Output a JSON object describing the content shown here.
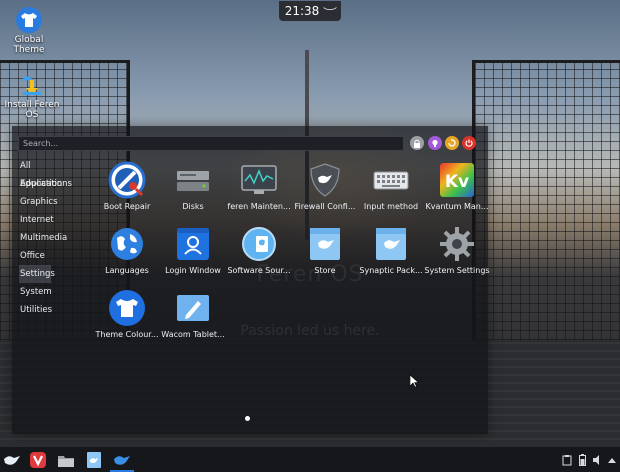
{
  "clock": {
    "time": "21:38",
    "chevron": "︶"
  },
  "desktop": {
    "icons": [
      {
        "name": "Global Theme",
        "icon": "tshirt-icon"
      },
      {
        "name": "Install Feren OS",
        "icon": "installer-icon"
      }
    ]
  },
  "launcher": {
    "search_placeholder": "Search...",
    "action_buttons": [
      {
        "icon": "lock-icon",
        "color": "#9aa0a6"
      },
      {
        "icon": "bulb-icon",
        "color": "#a15bd8"
      },
      {
        "icon": "switch-user-icon",
        "color": "#e6a526"
      },
      {
        "icon": "power-icon",
        "color": "#d8342c"
      }
    ],
    "categories": [
      {
        "label": "All Applications",
        "active": false
      },
      {
        "label": "Education",
        "active": false
      },
      {
        "label": "Graphics",
        "active": false
      },
      {
        "label": "Internet",
        "active": false
      },
      {
        "label": "Multimedia",
        "active": false
      },
      {
        "label": "Office",
        "active": false
      },
      {
        "label": "Settings",
        "active": true
      },
      {
        "label": "System",
        "active": false
      },
      {
        "label": "Utilities",
        "active": false
      }
    ],
    "apps": [
      {
        "label": "Boot Repair",
        "icon": "lifebuoy-icon"
      },
      {
        "label": "Disks",
        "icon": "disk-icon"
      },
      {
        "label": "feren Mainten...",
        "icon": "monitor-icon"
      },
      {
        "label": "Firewall Confi...",
        "icon": "shield-icon"
      },
      {
        "label": "Input method",
        "icon": "keyboard-icon"
      },
      {
        "label": "Kvantum Man...",
        "icon": "kvantum-icon"
      },
      {
        "label": "Languages",
        "icon": "globe-icon"
      },
      {
        "label": "Login Window",
        "icon": "login-icon"
      },
      {
        "label": "Software Sour...",
        "icon": "software-sources-icon"
      },
      {
        "label": "Store",
        "icon": "store-icon"
      },
      {
        "label": "Synaptic Pack...",
        "icon": "package-icon"
      },
      {
        "label": "System Settings",
        "icon": "gear-icon"
      },
      {
        "label": "Theme Colour...",
        "icon": "tshirt-icon"
      },
      {
        "label": "Wacom Tablet...",
        "icon": "tablet-pen-icon"
      }
    ],
    "page_indicator": {
      "pages": 1,
      "current": 1
    }
  },
  "wallpaper": {
    "title": "Feren OS",
    "subtitle": "Passion led us here."
  },
  "taskbar": {
    "items": [
      {
        "icon": "feren-bird-icon"
      },
      {
        "icon": "vivaldi-icon"
      },
      {
        "icon": "folder-icon"
      },
      {
        "icon": "store-icon"
      },
      {
        "icon": "feren-bird-icon"
      }
    ],
    "tray": [
      {
        "icon": "clipboard-icon"
      },
      {
        "icon": "battery-icon"
      },
      {
        "icon": "volume-icon"
      },
      {
        "icon": "tray-expand-icon"
      }
    ]
  },
  "colors": {
    "accent": "#2a7be0",
    "panel": "#15171b"
  }
}
